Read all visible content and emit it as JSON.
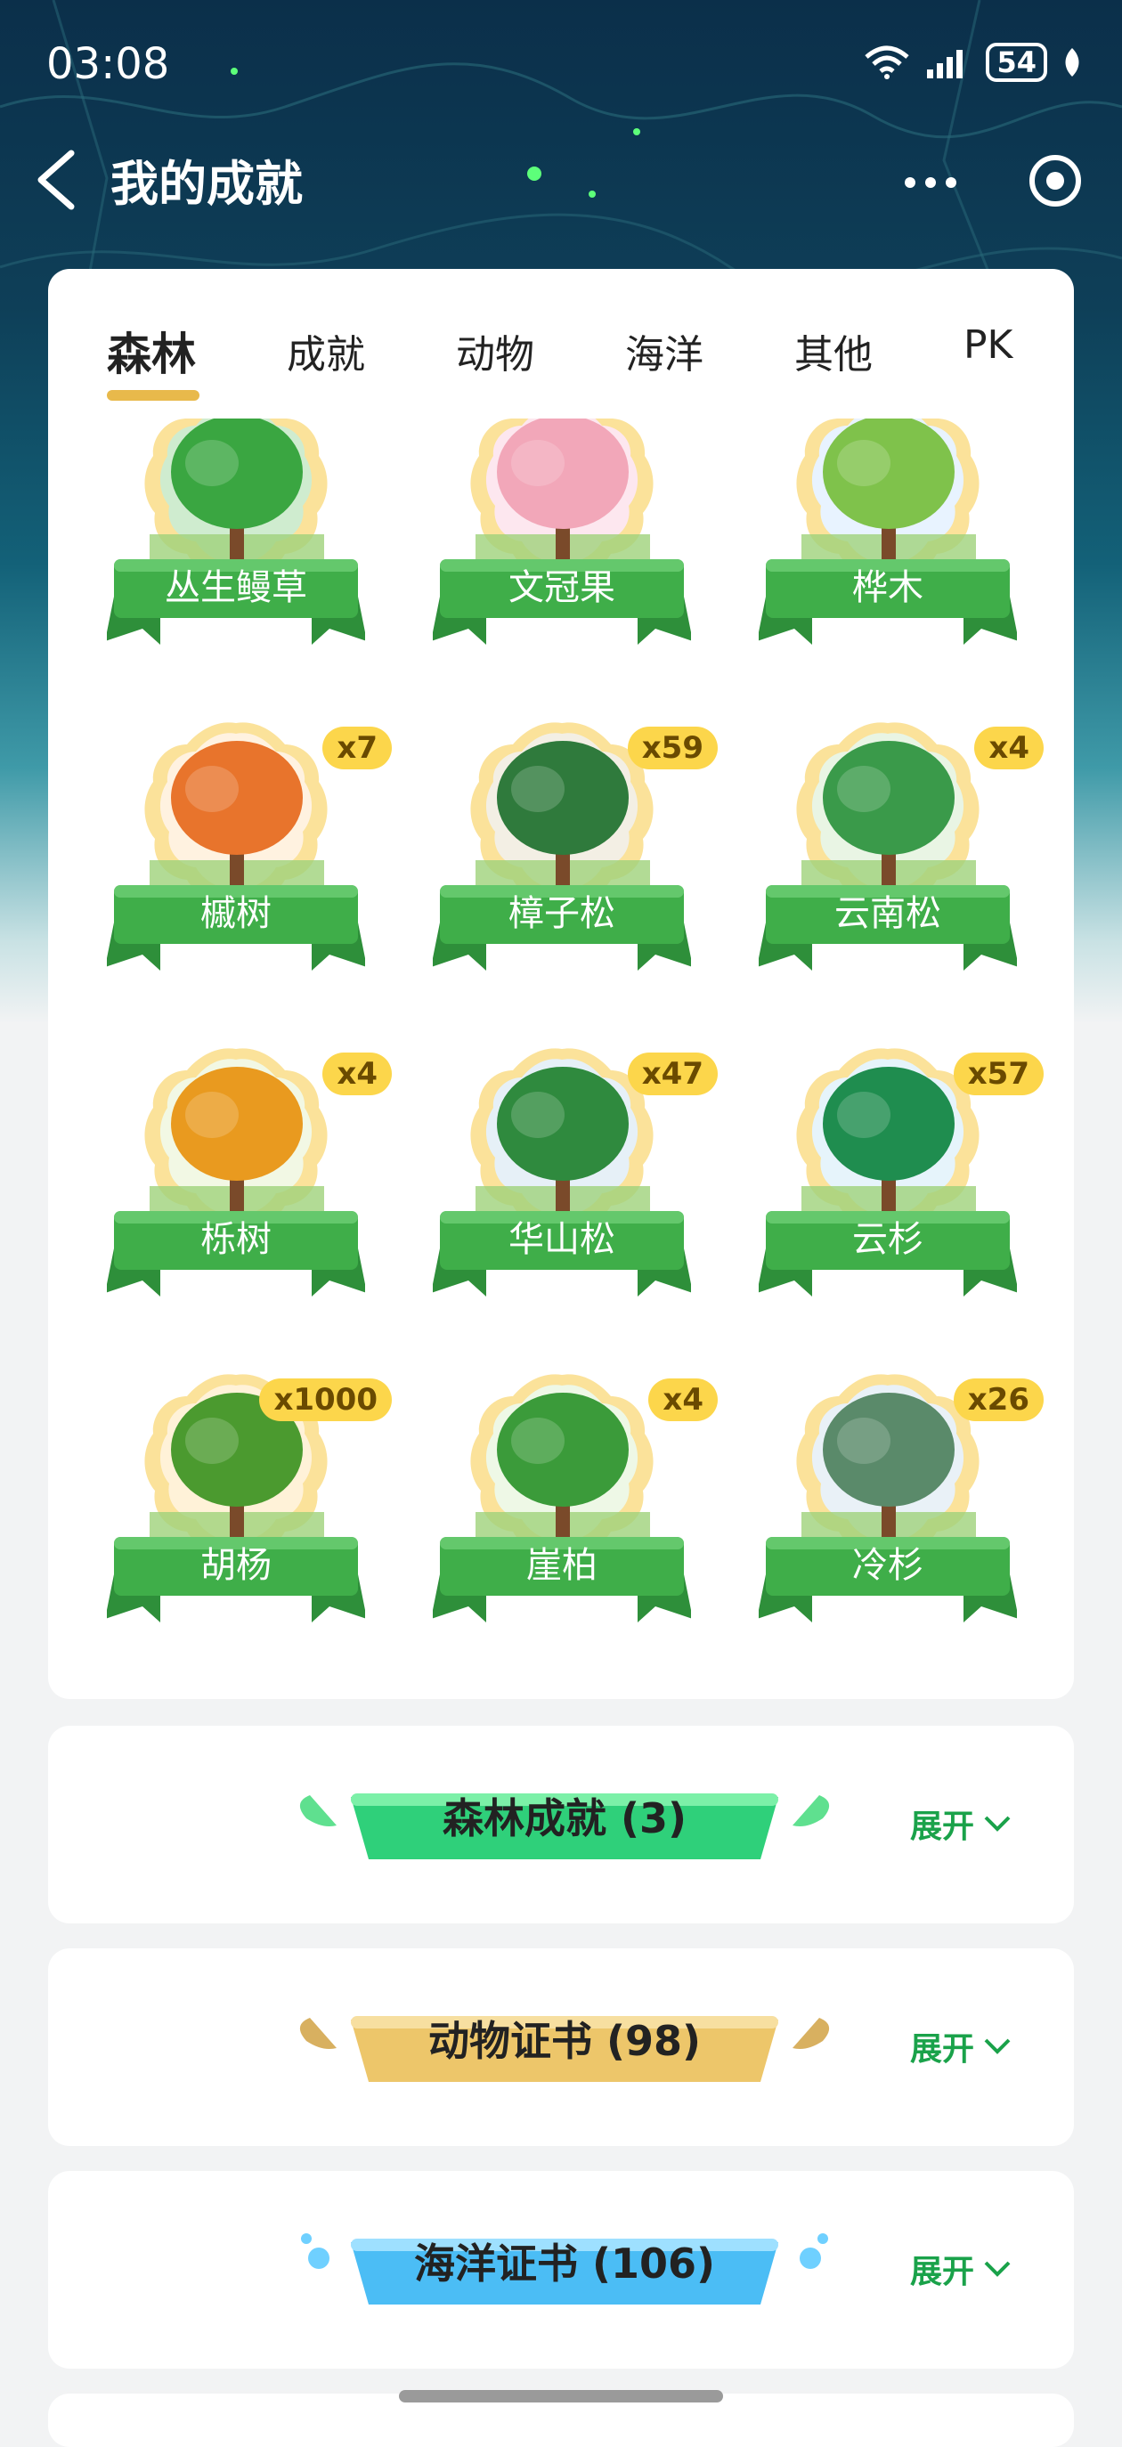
{
  "status": {
    "time": "03:08",
    "battery": "54"
  },
  "header": {
    "title": "我的成就"
  },
  "tabs": [
    {
      "label": "森林",
      "active": true
    },
    {
      "label": "成就"
    },
    {
      "label": "动物"
    },
    {
      "label": "海洋"
    },
    {
      "label": "其他"
    },
    {
      "label": "PK"
    }
  ],
  "items": [
    {
      "name": "丛生鳗草",
      "count": ""
    },
    {
      "name": "文冠果",
      "count": ""
    },
    {
      "name": "桦木",
      "count": ""
    },
    {
      "name": "槭树",
      "count": "x7"
    },
    {
      "name": "樟子松",
      "count": "x59"
    },
    {
      "name": "云南松",
      "count": "x4"
    },
    {
      "name": "栎树",
      "count": "x4"
    },
    {
      "name": "华山松",
      "count": "x47"
    },
    {
      "name": "云杉",
      "count": "x57"
    },
    {
      "name": "胡杨",
      "count": "x1000"
    },
    {
      "name": "崖柏",
      "count": "x4"
    },
    {
      "name": "冷杉",
      "count": "x26"
    }
  ],
  "sections": [
    {
      "title": "森林成就 (3)",
      "expand": "展开",
      "color": "#2fd07a"
    },
    {
      "title": "动物证书 (98)",
      "expand": "展开",
      "color": "#edc66a"
    },
    {
      "title": "海洋证书 (106)",
      "expand": "展开",
      "color": "#4bbdf5"
    }
  ],
  "colors": {
    "accent_green": "#1aa24a",
    "ribbon_green": "#3fae49",
    "badge_yellow": "#fcd64b",
    "tab_underline": "#e8b94b"
  }
}
